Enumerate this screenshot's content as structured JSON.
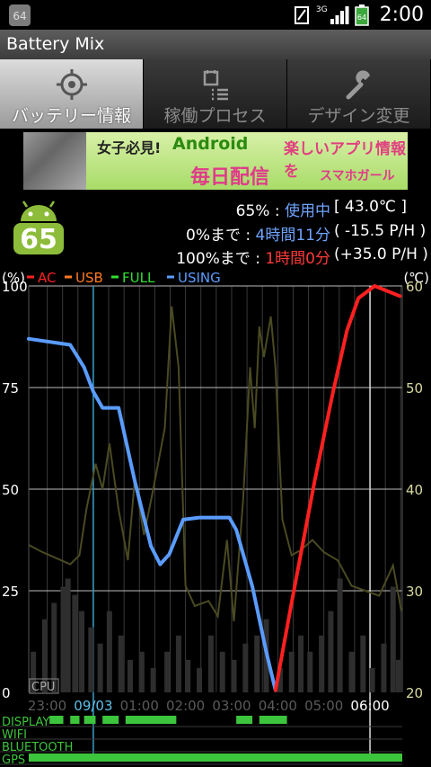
{
  "status_bar": {
    "time": "2:00",
    "network": "3G",
    "battery_level": "64",
    "app_icon_text": "64"
  },
  "app_title": "Battery Mix",
  "tabs": [
    {
      "label": "バッテリー情報",
      "icon": "crosshair-icon",
      "active": true
    },
    {
      "label": "稼働プロセス",
      "icon": "process-list-icon",
      "active": false
    },
    {
      "label": "デザイン変更",
      "icon": "wrench-icon",
      "active": false
    }
  ],
  "banner": {
    "text1": "女子必見!",
    "text2": "Android",
    "text3": "楽しいアプリ情報を",
    "text4": "毎日配信",
    "text5": "スマホガール"
  },
  "battery": {
    "icon_value": "65",
    "line1_value": "65%",
    "line1_sep": " : ",
    "line1_status": "使用中",
    "line1_temp": "[ 43.0℃ ]",
    "line2_label": "0%まで",
    "line2_sep": " : ",
    "line2_time": "4時間11分",
    "line2_rate": "( -15.5 P/H )",
    "line3_label": "100%まで",
    "line3_sep": " : ",
    "line3_time": "1時間0分",
    "line3_rate": "(+35.0 P/H )"
  },
  "legend": {
    "unit_left": "(%)",
    "unit_right": "(℃)",
    "items": [
      {
        "label": "AC",
        "color": "#ff2020"
      },
      {
        "label": "USB",
        "color": "#ff7a20"
      },
      {
        "label": "FULL",
        "color": "#30e030"
      },
      {
        "label": "USING",
        "color": "#5a9cff"
      }
    ]
  },
  "chart_data": {
    "type": "line",
    "y_left_ticks": [
      "100",
      "75",
      "50",
      "25",
      "0"
    ],
    "y_right_ticks": [
      "60",
      "50",
      "40",
      "30",
      "20"
    ],
    "ylim_left": [
      0,
      100
    ],
    "ylim_right": [
      20,
      60
    ],
    "x_ticks": [
      "23:00",
      "09/03",
      "01:00",
      "02:00",
      "03:00",
      "04:00",
      "05:00",
      "06:00"
    ],
    "x_hours": [
      23,
      24,
      25,
      26,
      27,
      28,
      29,
      30
    ],
    "cpu_label": "CPU",
    "series": [
      {
        "name": "USING",
        "color": "#5a9cff",
        "points": [
          [
            22.6,
            87
          ],
          [
            23.5,
            85.5
          ],
          [
            23.8,
            80
          ],
          [
            24.0,
            74
          ],
          [
            24.2,
            70
          ],
          [
            24.55,
            70
          ],
          [
            24.9,
            52
          ],
          [
            25.25,
            36
          ],
          [
            25.45,
            31.5
          ],
          [
            25.65,
            34
          ],
          [
            25.95,
            42.5
          ],
          [
            26.3,
            43
          ],
          [
            26.95,
            43
          ],
          [
            27.1,
            40
          ],
          [
            27.45,
            26
          ],
          [
            27.75,
            10
          ],
          [
            27.95,
            0.5
          ]
        ]
      },
      {
        "name": "AC",
        "color": "#ff2020",
        "points": [
          [
            27.95,
            0.5
          ],
          [
            28.3,
            22
          ],
          [
            28.8,
            52
          ],
          [
            29.2,
            74
          ],
          [
            29.5,
            89
          ],
          [
            29.75,
            97
          ],
          [
            30.1,
            100
          ],
          [
            30.65,
            97.5
          ]
        ]
      }
    ],
    "temperature": {
      "name": "Temperature",
      "color": "#4a4a22",
      "points": [
        [
          22.6,
          34.5
        ],
        [
          22.9,
          33.8
        ],
        [
          23.5,
          32.6
        ],
        [
          23.7,
          33.5
        ],
        [
          23.85,
          38
        ],
        [
          24.05,
          42.5
        ],
        [
          24.2,
          40
        ],
        [
          24.35,
          44.5
        ],
        [
          24.55,
          38
        ],
        [
          24.75,
          33
        ],
        [
          24.9,
          41
        ],
        [
          25.1,
          35.5
        ],
        [
          25.3,
          40
        ],
        [
          25.55,
          46
        ],
        [
          25.7,
          58
        ],
        [
          25.85,
          52
        ],
        [
          26.0,
          30.5
        ],
        [
          26.2,
          28.5
        ],
        [
          26.5,
          29
        ],
        [
          26.7,
          27.5
        ],
        [
          26.9,
          35
        ],
        [
          27.05,
          27
        ],
        [
          27.25,
          39
        ],
        [
          27.4,
          52
        ],
        [
          27.5,
          46
        ],
        [
          27.6,
          56
        ],
        [
          27.7,
          53
        ],
        [
          27.85,
          57
        ],
        [
          27.95,
          52
        ],
        [
          28.1,
          37
        ],
        [
          28.3,
          33.5
        ],
        [
          28.5,
          34
        ],
        [
          28.75,
          35
        ],
        [
          29.0,
          33.8
        ],
        [
          29.3,
          33
        ],
        [
          29.6,
          30.5
        ],
        [
          29.9,
          30
        ],
        [
          30.2,
          29.5
        ],
        [
          30.5,
          32.5
        ],
        [
          30.68,
          28
        ]
      ]
    },
    "cpu_bars": [
      {
        "x": 22.7,
        "v": 10
      },
      {
        "x": 22.95,
        "v": 18
      },
      {
        "x": 23.15,
        "v": 22
      },
      {
        "x": 23.35,
        "v": 26
      },
      {
        "x": 23.45,
        "v": 28
      },
      {
        "x": 23.6,
        "v": 24
      },
      {
        "x": 23.75,
        "v": 20
      },
      {
        "x": 23.95,
        "v": 16
      },
      {
        "x": 24.15,
        "v": 12
      },
      {
        "x": 24.35,
        "v": 20
      },
      {
        "x": 24.6,
        "v": 14
      },
      {
        "x": 24.8,
        "v": 8
      },
      {
        "x": 25.05,
        "v": 10
      },
      {
        "x": 25.3,
        "v": 6
      },
      {
        "x": 25.6,
        "v": 10
      },
      {
        "x": 25.85,
        "v": 14
      },
      {
        "x": 26.05,
        "v": 8
      },
      {
        "x": 26.3,
        "v": 6
      },
      {
        "x": 26.55,
        "v": 14
      },
      {
        "x": 26.8,
        "v": 10
      },
      {
        "x": 27.05,
        "v": 8
      },
      {
        "x": 27.3,
        "v": 12
      },
      {
        "x": 27.55,
        "v": 14
      },
      {
        "x": 27.75,
        "v": 18
      },
      {
        "x": 28.05,
        "v": 6
      },
      {
        "x": 28.3,
        "v": 10
      },
      {
        "x": 28.5,
        "v": 14
      },
      {
        "x": 28.7,
        "v": 10
      },
      {
        "x": 28.95,
        "v": 14
      },
      {
        "x": 29.15,
        "v": 20
      },
      {
        "x": 29.35,
        "v": 28
      },
      {
        "x": 29.6,
        "v": 10
      },
      {
        "x": 29.85,
        "v": 14
      },
      {
        "x": 30.05,
        "v": 6
      },
      {
        "x": 30.3,
        "v": 12
      },
      {
        "x": 30.5,
        "v": 26
      },
      {
        "x": 30.62,
        "v": 8
      }
    ]
  },
  "state_rows": [
    {
      "label": "DISPLAY",
      "segments": [
        [
          23.05,
          23.35
        ],
        [
          23.5,
          23.7
        ],
        [
          23.8,
          24.05
        ],
        [
          24.2,
          24.55
        ],
        [
          24.7,
          25.8
        ],
        [
          27.1,
          27.45
        ],
        [
          27.6,
          28.2
        ]
      ]
    },
    {
      "label": "WIFI",
      "segments": []
    },
    {
      "label": "BLUETOOTH",
      "segments": []
    },
    {
      "label": "GPS",
      "segments": [
        [
          22.6,
          30.7
        ]
      ]
    }
  ]
}
